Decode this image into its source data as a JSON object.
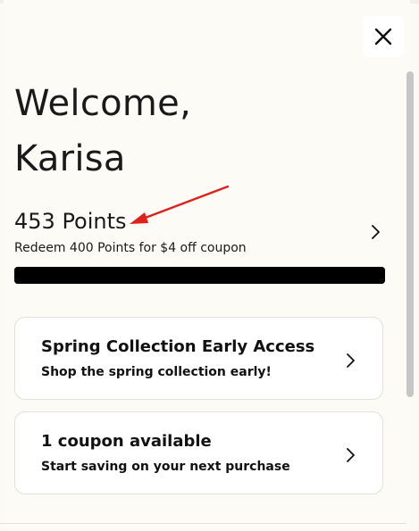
{
  "header": {
    "welcome_line1": "Welcome,",
    "welcome_line2": "Karisa",
    "close_icon": "close-icon"
  },
  "points": {
    "title": "453 Points",
    "subtitle": "Redeem 400 Points for $4 off coupon",
    "progress_fraction": 1.0
  },
  "cards": [
    {
      "title": "Spring Collection Early Access",
      "subtitle": "Shop the spring collection early!"
    },
    {
      "title": "1 coupon available",
      "subtitle": "Start saving on your next purchase"
    }
  ],
  "colors": {
    "background": "#fbfaf5",
    "card": "#ffffff",
    "progress": "#000000",
    "annotation_arrow": "#e0201b",
    "text": "#111111"
  }
}
